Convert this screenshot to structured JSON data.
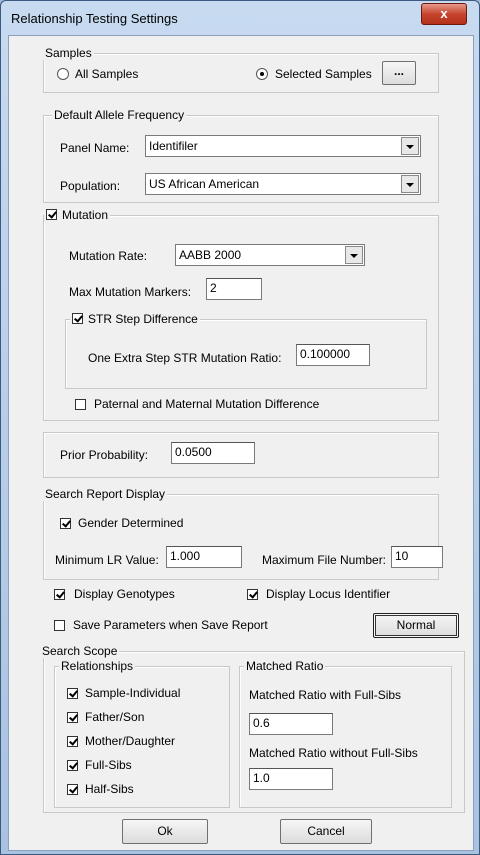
{
  "window": {
    "title": "Relationship Testing Settings",
    "close_glyph": "x"
  },
  "samples": {
    "label": "Samples",
    "all_label": "All Samples",
    "selected_label": "Selected Samples",
    "browse_label": "...",
    "selected": "selected"
  },
  "allele": {
    "label": "Default Allele Frequency",
    "panel_label": "Panel Name:",
    "panel_value": "Identifiler",
    "population_label": "Population:",
    "population_value": "US African American"
  },
  "mutation": {
    "label": "Mutation",
    "checked": true,
    "rate_label": "Mutation Rate:",
    "rate_value": "AABB 2000",
    "max_markers_label": "Max Mutation Markers:",
    "max_markers_value": "2",
    "str_step_label": "STR Step Difference",
    "str_step_checked": true,
    "extra_step_label": "One Extra Step STR Mutation Ratio:",
    "extra_step_value": "0.100000",
    "paternal_label": "Paternal and Maternal Mutation Difference",
    "paternal_checked": false
  },
  "prior": {
    "label": "Prior Probability:",
    "value": "0.0500"
  },
  "search_report": {
    "label": "Search Report Display",
    "gender_label": "Gender Determined",
    "gender_checked": true,
    "min_lr_label": "Minimum LR Value:",
    "min_lr_value": "1.000",
    "max_file_label": "Maximum File Number:",
    "max_file_value": "10"
  },
  "display": {
    "genotypes_label": "Display Genotypes",
    "genotypes_checked": true,
    "locus_label": "Display Locus Identifier",
    "locus_checked": true,
    "save_params_label": "Save Parameters when  Save Report",
    "save_params_checked": false,
    "normal_label": "Normal"
  },
  "search_scope": {
    "label": "Search Scope",
    "relationships_label": "Relationships",
    "relationships": [
      {
        "label": "Sample-Individual",
        "checked": true
      },
      {
        "label": "Father/Son",
        "checked": true
      },
      {
        "label": "Mother/Daughter",
        "checked": true
      },
      {
        "label": "Full-Sibs",
        "checked": true
      },
      {
        "label": "Half-Sibs",
        "checked": true
      }
    ],
    "matched_label": "Matched Ratio",
    "with_fullsibs_label": "Matched Ratio with Full-Sibs",
    "with_fullsibs_value": "0.6",
    "without_fullsibs_label": "Matched Ratio without Full-Sibs",
    "without_fullsibs_value": "1.0"
  },
  "buttons": {
    "ok": "Ok",
    "cancel": "Cancel"
  }
}
